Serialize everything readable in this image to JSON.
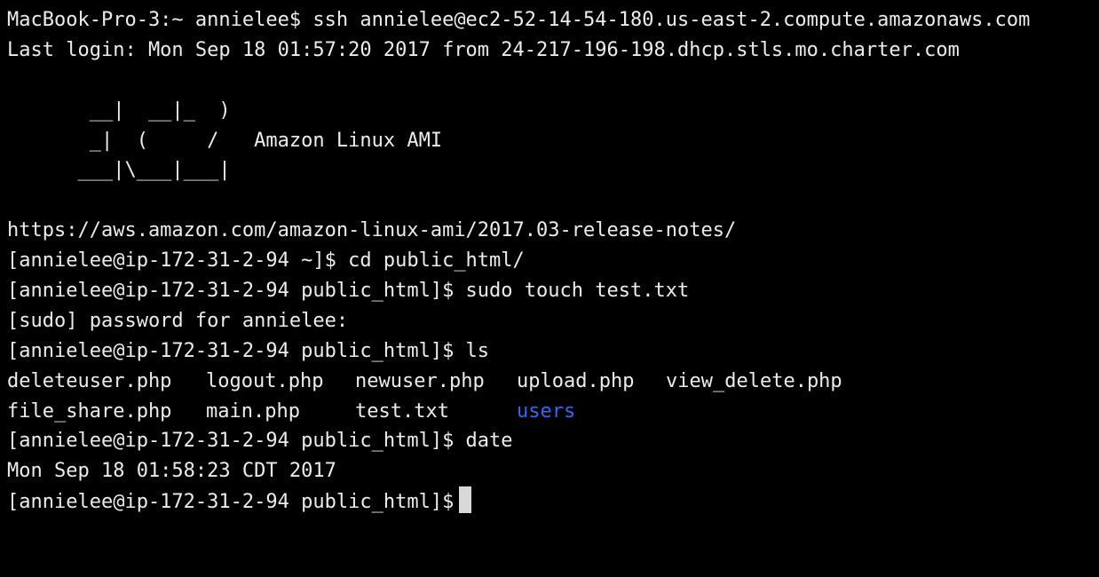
{
  "terminal": {
    "lines": [
      "MacBook-Pro-3:~ annielee$ ssh annielee@ec2-52-14-54-180.us-east-2.compute.amazonaws.com",
      "Last login: Mon Sep 18 01:57:20 2017 from 24-217-196-198.dhcp.stls.mo.charter.com",
      "",
      "       __|  __|_  )",
      "       _|  (     /   Amazon Linux AMI",
      "      ___|\\___|___|",
      "",
      "https://aws.amazon.com/amazon-linux-ami/2017.03-release-notes/",
      "[annielee@ip-172-31-2-94 ~]$ cd public_html/",
      "[annielee@ip-172-31-2-94 public_html]$ sudo touch test.txt",
      "[sudo] password for annielee:",
      "[annielee@ip-172-31-2-94 public_html]$ ls"
    ],
    "ls_rows": [
      [
        "deleteuser.php",
        "logout.php",
        "newuser.php",
        "upload.php",
        "view_delete.php"
      ],
      [
        "file_share.php",
        "main.php",
        "test.txt",
        "users",
        ""
      ]
    ],
    "directory_entries": [
      "users"
    ],
    "after_lines": [
      "[annielee@ip-172-31-2-94 public_html]$ date",
      "Mon Sep 18 01:58:23 CDT 2017"
    ],
    "prompt": "[annielee@ip-172-31-2-94 public_html]$",
    "colors": {
      "background": "#000000",
      "text": "#ececec",
      "directory": "#2f6bf2",
      "cursor": "#d9d9d9"
    }
  }
}
